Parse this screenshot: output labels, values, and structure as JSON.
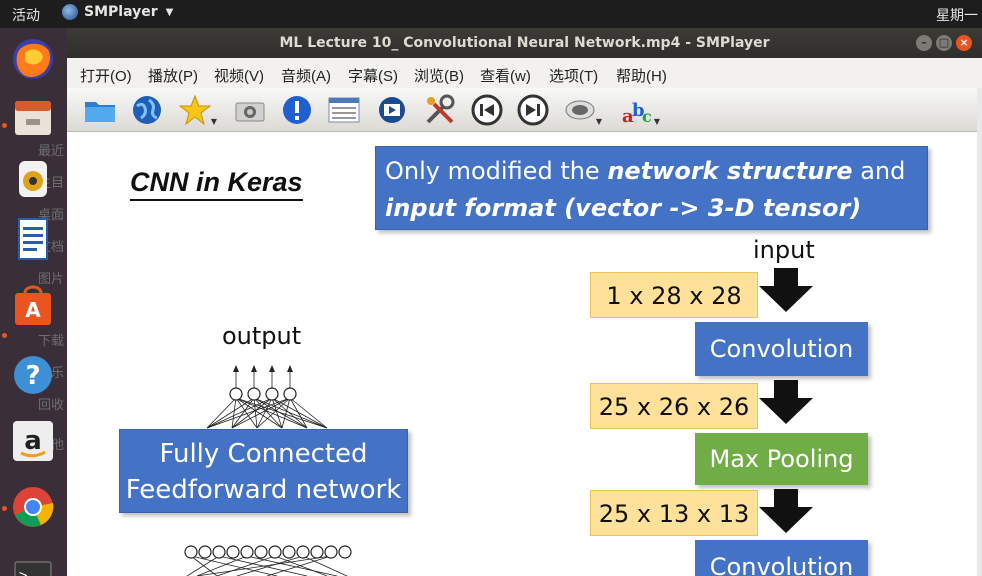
{
  "topbar": {
    "activities": "活动",
    "app_name": "SMPlayer",
    "clock": "星期一"
  },
  "dock": {
    "items": [
      "firefox-icon",
      "files-icon",
      "rhythmbox-icon",
      "writer-icon",
      "software-icon",
      "help-icon",
      "amazon-icon",
      "chrome-icon",
      "terminal-icon"
    ],
    "bg_text": [
      "最近",
      "主目",
      "桌面",
      "文档",
      "图片",
      "下载",
      "音乐",
      "回收",
      "其他"
    ]
  },
  "window": {
    "title": "ML Lecture 10_ Convolutional Neural Network.mp4 - SMPlayer"
  },
  "menu": [
    "打开(O)",
    "播放(P)",
    "视频(V)",
    "音频(A)",
    "字幕(S)",
    "浏览(B)",
    "查看(w)",
    "选项(T)",
    "帮助(H)"
  ],
  "toolbar": [
    "open-folder-icon",
    "open-url-icon",
    "favorites-icon",
    "screenshot-icon",
    "info-icon",
    "playlist-icon",
    "media-icon",
    "preferences-icon",
    "previous-icon",
    "next-icon",
    "audio-icon",
    "subtitles-icon"
  ],
  "slide": {
    "title": "CNN in Keras",
    "note_line1_a": "Only modified the ",
    "note_line1_b": "network structure",
    "note_line1_c": " and",
    "note_line2": "input format (vector -> 3-D tensor)",
    "output_label": "output",
    "fc_line1": "Fully Connected",
    "fc_line2": "Feedforward network",
    "input_label": "input",
    "dims": [
      "1 x 28 x 28",
      "25 x 26 x 26",
      "25 x 13 x 13"
    ],
    "layers": [
      "Convolution",
      "Max Pooling",
      "Convolution"
    ]
  }
}
